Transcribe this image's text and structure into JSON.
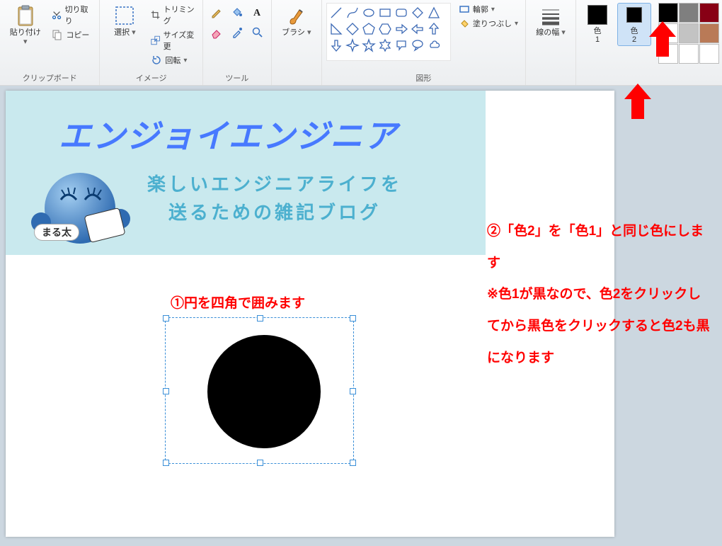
{
  "ribbon": {
    "clipboard": {
      "label": "クリップボード",
      "paste": "貼り付け",
      "cut": "切り取り",
      "copy": "コピー"
    },
    "image": {
      "label": "イメージ",
      "select": "選択",
      "trim": "トリミング",
      "resize": "サイズ変更",
      "rotate": "回転"
    },
    "tools": {
      "label": "ツール",
      "icons": [
        "pencil",
        "bucket",
        "text",
        "eraser",
        "picker",
        "magnifier"
      ]
    },
    "brush": {
      "label": "ブラシ"
    },
    "shapes": {
      "label": "図形",
      "outline": "輪郭",
      "fill": "塗りつぶし",
      "list": [
        "line",
        "curve",
        "oval",
        "rect",
        "round-rect",
        "polygon",
        "triangle",
        "right-triangle",
        "diamond",
        "pentagon",
        "hexagon",
        "arrow-right",
        "arrow-left",
        "arrow-up",
        "arrow-down",
        "star-4",
        "star-5",
        "star-6",
        "callout-round",
        "callout-oval",
        "callout-cloud"
      ]
    },
    "line": {
      "label": "線の幅"
    },
    "colors": {
      "color1_label": "色\n1",
      "color2_label": "色\n2",
      "color1_value": "#000000",
      "color2_value": "#000000",
      "palette": [
        "#000000",
        "#7f7f7f",
        "#880015",
        "#ffffff",
        "#c3c3c3",
        "#b97a57",
        "#ffffff",
        "#ffffff",
        "#ffffff"
      ]
    }
  },
  "canvas": {
    "banner": {
      "title": "エンジョイエンジニア",
      "subtitle1": "楽しいエンジニアライフを",
      "subtitle2": "送るための雑記ブログ",
      "mascot_label": "まる太"
    }
  },
  "annotations": {
    "step1": "①円を四角で囲みます",
    "step2": "②「色2」を「色1」と同じ色にします\n※色1が黒なので、色2をクリックしてから黒色をクリックすると色2も黒になります"
  }
}
